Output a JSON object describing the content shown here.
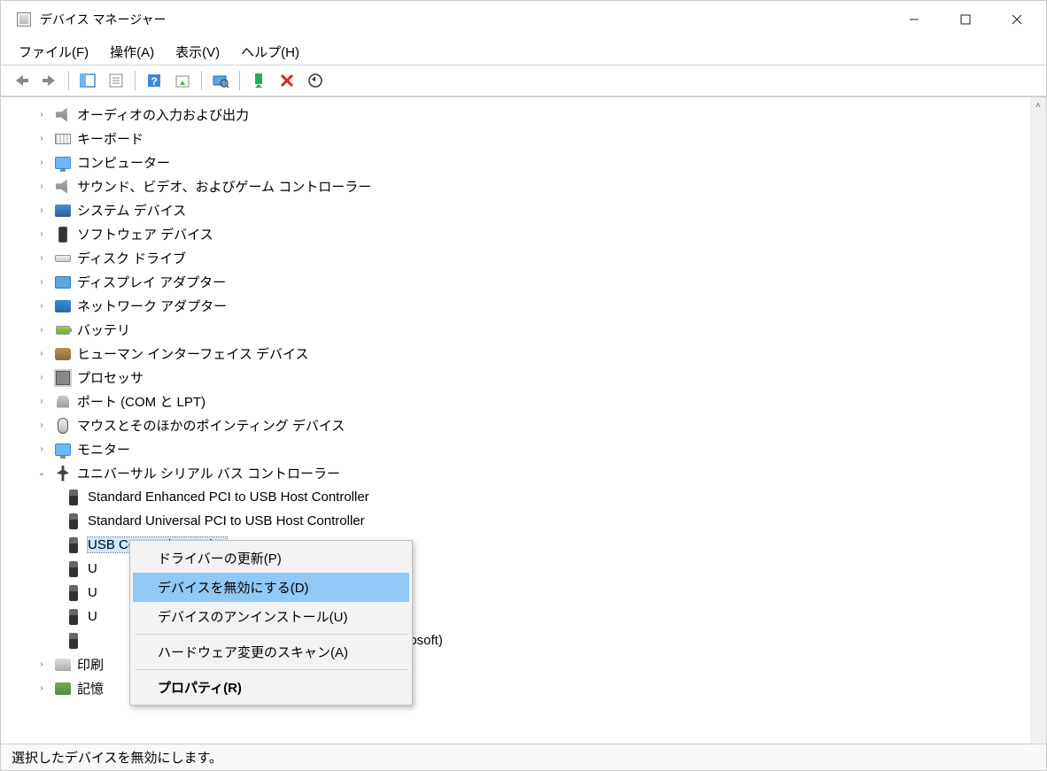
{
  "window": {
    "title": "デバイス マネージャー"
  },
  "menu": {
    "file": "ファイル(F)",
    "action": "操作(A)",
    "view": "表示(V)",
    "help": "ヘルプ(H)"
  },
  "categories": [
    {
      "id": "audio",
      "label": "オーディオの入力および出力",
      "icon": "ic-audio"
    },
    {
      "id": "keyboard",
      "label": "キーボード",
      "icon": "ic-keyboard"
    },
    {
      "id": "computer",
      "label": "コンピューター",
      "icon": "ic-monitor"
    },
    {
      "id": "sound",
      "label": "サウンド、ビデオ、およびゲーム コントローラー",
      "icon": "ic-audio"
    },
    {
      "id": "system",
      "label": "システム デバイス",
      "icon": "ic-system"
    },
    {
      "id": "software",
      "label": "ソフトウェア デバイス",
      "icon": "ic-phone"
    },
    {
      "id": "disk",
      "label": "ディスク ドライブ",
      "icon": "ic-disk"
    },
    {
      "id": "display",
      "label": "ディスプレイ アダプター",
      "icon": "ic-display"
    },
    {
      "id": "network",
      "label": "ネットワーク アダプター",
      "icon": "ic-network"
    },
    {
      "id": "battery",
      "label": "バッテリ",
      "icon": "ic-battery"
    },
    {
      "id": "hid",
      "label": "ヒューマン インターフェイス デバイス",
      "icon": "ic-hid"
    },
    {
      "id": "cpu",
      "label": "プロセッサ",
      "icon": "ic-cpu"
    },
    {
      "id": "ports",
      "label": "ポート (COM と LPT)",
      "icon": "ic-port"
    },
    {
      "id": "mouse",
      "label": "マウスとそのほかのポインティング デバイス",
      "icon": "ic-mouse"
    },
    {
      "id": "monitor",
      "label": "モニター",
      "icon": "ic-monitor"
    }
  ],
  "usb_category": {
    "label": "ユニバーサル シリアル バス コントローラー",
    "icon": "ic-usb-hub"
  },
  "usb_children": [
    {
      "label": "Standard Enhanced PCI to USB Host Controller"
    },
    {
      "label": "Standard Universal PCI to USB Host Controller"
    },
    {
      "label": "USB Composite Device",
      "selected": true
    },
    {
      "label": "U"
    },
    {
      "label": "U"
    },
    {
      "label": "U"
    }
  ],
  "usb_tail_fragment": " (Microsoft)",
  "tail_categories": [
    {
      "id": "print",
      "label": "印刷",
      "icon": "ic-printer"
    },
    {
      "id": "storage",
      "label": "記憶",
      "icon": "ic-storage"
    }
  ],
  "context_menu": {
    "update": "ドライバーの更新(P)",
    "disable": "デバイスを無効にする(D)",
    "uninstall": "デバイスのアンインストール(U)",
    "scan": "ハードウェア変更のスキャン(A)",
    "props": "プロパティ(R)"
  },
  "status": "選択したデバイスを無効にします。"
}
